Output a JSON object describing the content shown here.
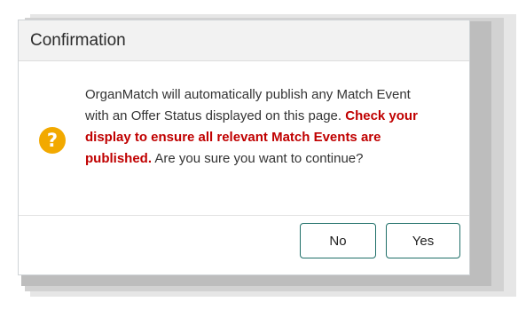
{
  "dialog": {
    "title": "Confirmation",
    "message_part1": "OrganMatch will automatically publish any Match Event with an Offer Status displayed on this page. ",
    "message_warning": "Check your display to ensure all relevant Match Events are published.",
    "message_part2": " Are you sure you want to continue?",
    "icon": "question-icon",
    "icon_glyph": "?",
    "buttons": {
      "no_label": "No",
      "yes_label": "Yes"
    }
  },
  "colors": {
    "icon": "#f2a900",
    "warning_text": "#c00000",
    "button_border": "#1f6f68"
  }
}
